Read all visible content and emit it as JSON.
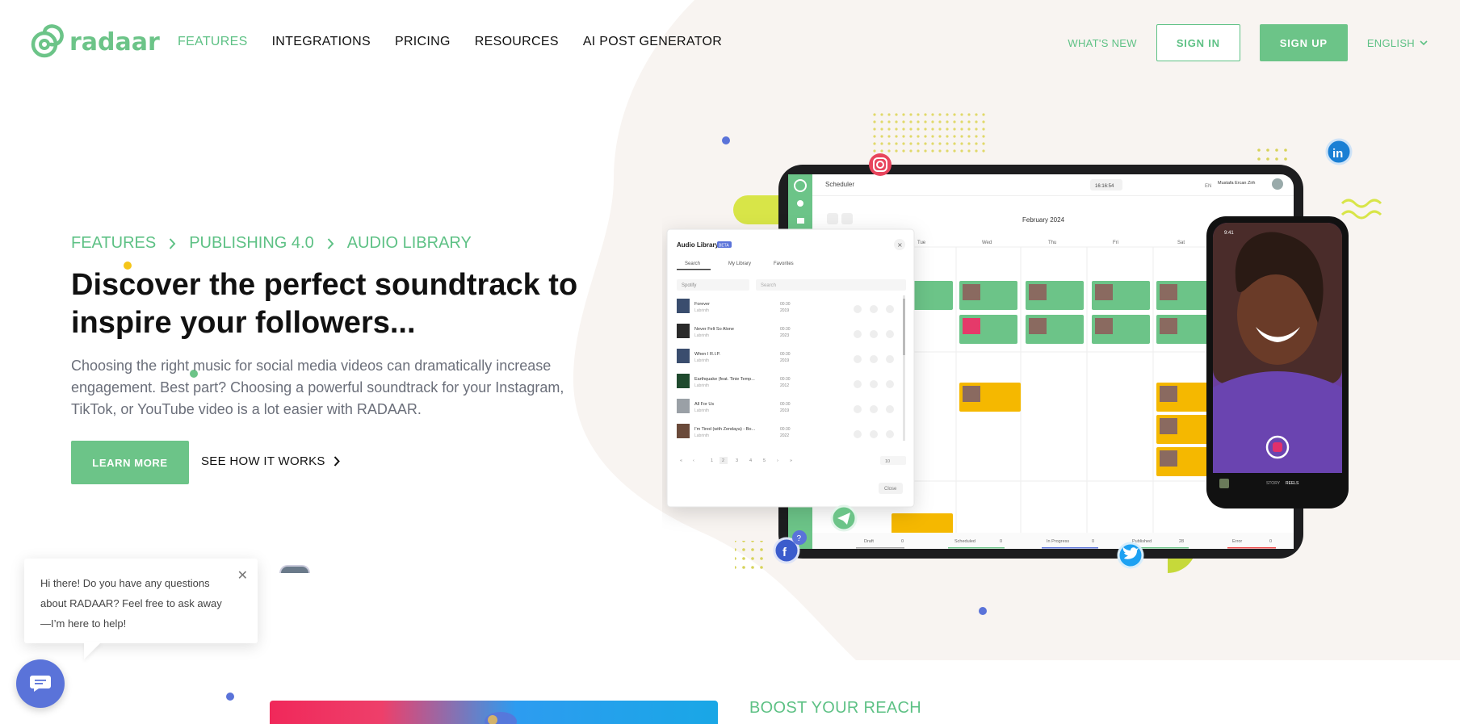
{
  "header": {
    "logo_text": "radaar",
    "nav": [
      {
        "label": "FEATURES",
        "active": true
      },
      {
        "label": "INTEGRATIONS",
        "active": false
      },
      {
        "label": "PRICING",
        "active": false
      },
      {
        "label": "RESOURCES",
        "active": false
      },
      {
        "label": "AI POST GENERATOR",
        "active": false
      }
    ],
    "whats_new": "WHAT'S NEW",
    "sign_in": "SIGN IN",
    "sign_up": "SIGN UP",
    "language": "ENGLISH"
  },
  "hero": {
    "breadcrumb": [
      "FEATURES",
      "PUBLISHING 4.0",
      "AUDIO LIBRARY"
    ],
    "title": "Discover the perfect soundtrack to inspire your followers...",
    "description": "Choosing the right music for social media videos can dramatically increase engagement. Best part? Choosing a powerful soundtrack for your Instagram, TikTok, or YouTube video is a lot easier with RADAAR.",
    "learn_more": "LEARN MORE",
    "see_how": "SEE HOW IT WORKS"
  },
  "mockup": {
    "app_title": "Scheduler",
    "clock": "16:16:54",
    "user": "Mustafa Ercan Zirh",
    "lang": "EN",
    "month": "February 2024",
    "days": [
      "Tue",
      "Wed",
      "Thu",
      "Fri",
      "Sat"
    ],
    "audio_library": {
      "title": "Audio Library",
      "badge": "BETA",
      "tabs": [
        "Search",
        "My Library",
        "Favorites"
      ],
      "source": "Spotify",
      "search_placeholder": "Search",
      "tracks": [
        {
          "name": "Forever",
          "artist": "Labrinth",
          "time": "00:30",
          "year": "2019"
        },
        {
          "name": "Never Felt So Alone",
          "artist": "Labrinth",
          "time": "00:30",
          "year": "2023"
        },
        {
          "name": "When I R.I.P.",
          "artist": "Labrinth",
          "time": "00:30",
          "year": "2019"
        },
        {
          "name": "Earthquake (feat. Tinie Temp...",
          "artist": "Labrinth",
          "time": "00:30",
          "year": "2012"
        },
        {
          "name": "All For Us",
          "artist": "Labrinth",
          "time": "00:30",
          "year": "2019"
        },
        {
          "name": "I'm Tired (with Zendaya) - Bo...",
          "artist": "Labrinth",
          "time": "00:30",
          "year": "2022"
        }
      ],
      "pages": [
        "1",
        "2",
        "3",
        "4",
        "5"
      ],
      "page_size": "10",
      "close": "Close"
    },
    "status_bar": [
      {
        "label": "Draft",
        "count": "0"
      },
      {
        "label": "Scheduled",
        "count": "0"
      },
      {
        "label": "In Progress",
        "count": "0"
      },
      {
        "label": "Published",
        "count": "28"
      },
      {
        "label": "Error",
        "count": "0"
      }
    ],
    "phone": {
      "time": "9:41",
      "tabs": [
        "STORY",
        "REELS"
      ]
    }
  },
  "chat": {
    "message": "Hi there! Do you have any questions about RADAAR? Feel free to ask away—I’m here to help!"
  },
  "section2": {
    "heading": "BOOST YOUR REACH"
  },
  "colors": {
    "brand_green": "#6cc488",
    "accent_blue": "#5a73d9",
    "blob": "#f8f4f1"
  }
}
